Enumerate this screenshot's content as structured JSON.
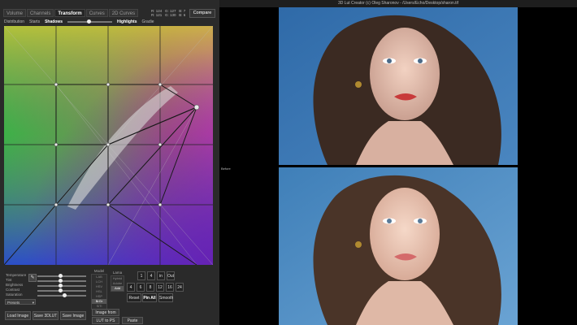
{
  "tabs": [
    "Volume",
    "Channels",
    "Transform",
    "Curves",
    "2D Curves"
  ],
  "active_tab": "Transform",
  "readout": [
    "R: 124   G: 127   B: 7",
    "R: 121   G: 130   B: 6"
  ],
  "compare_label": "Compare",
  "subtabs": [
    "Distribution",
    "Starts",
    "Shadows",
    "Highlights",
    "Gradie"
  ],
  "window_title": "3D Lut Creator (c) Oleg Sharonov - /Users/Echo/Desktop/sharon.tif",
  "before_label": "Before",
  "controls": {
    "sliders": [
      "Temperature",
      "Tint",
      "Brightness",
      "Contrast",
      "Saturation"
    ],
    "preset_value": "Presets",
    "model_label": "Model",
    "model_items": [
      "LAB",
      "LCH",
      "HSV",
      "HSL",
      "HSP",
      "BrGr",
      "SiTi"
    ],
    "model_selected": "BrGr",
    "lama_label": "Lama",
    "lama_items": [
      "Hybrid",
      "Adobe",
      "Add"
    ],
    "lama_selected": "Add",
    "grid_buttons_row1": [
      "1",
      "4",
      "in",
      "Out"
    ],
    "grid_buttons_row2": [
      "4",
      "6",
      "8",
      "12",
      "16",
      "24"
    ],
    "reset_label": "Reset",
    "pin_all_label": "Pin All",
    "smooth_label": "Smooth",
    "load_image_label": "Load Image",
    "save_3dlut_label": "Save 3DLUT",
    "save_image_label": "Save Image",
    "image_from_ps_label": "Image from PS",
    "lut_to_ps_label": "LUT to PS",
    "paste_label": "Paste"
  }
}
